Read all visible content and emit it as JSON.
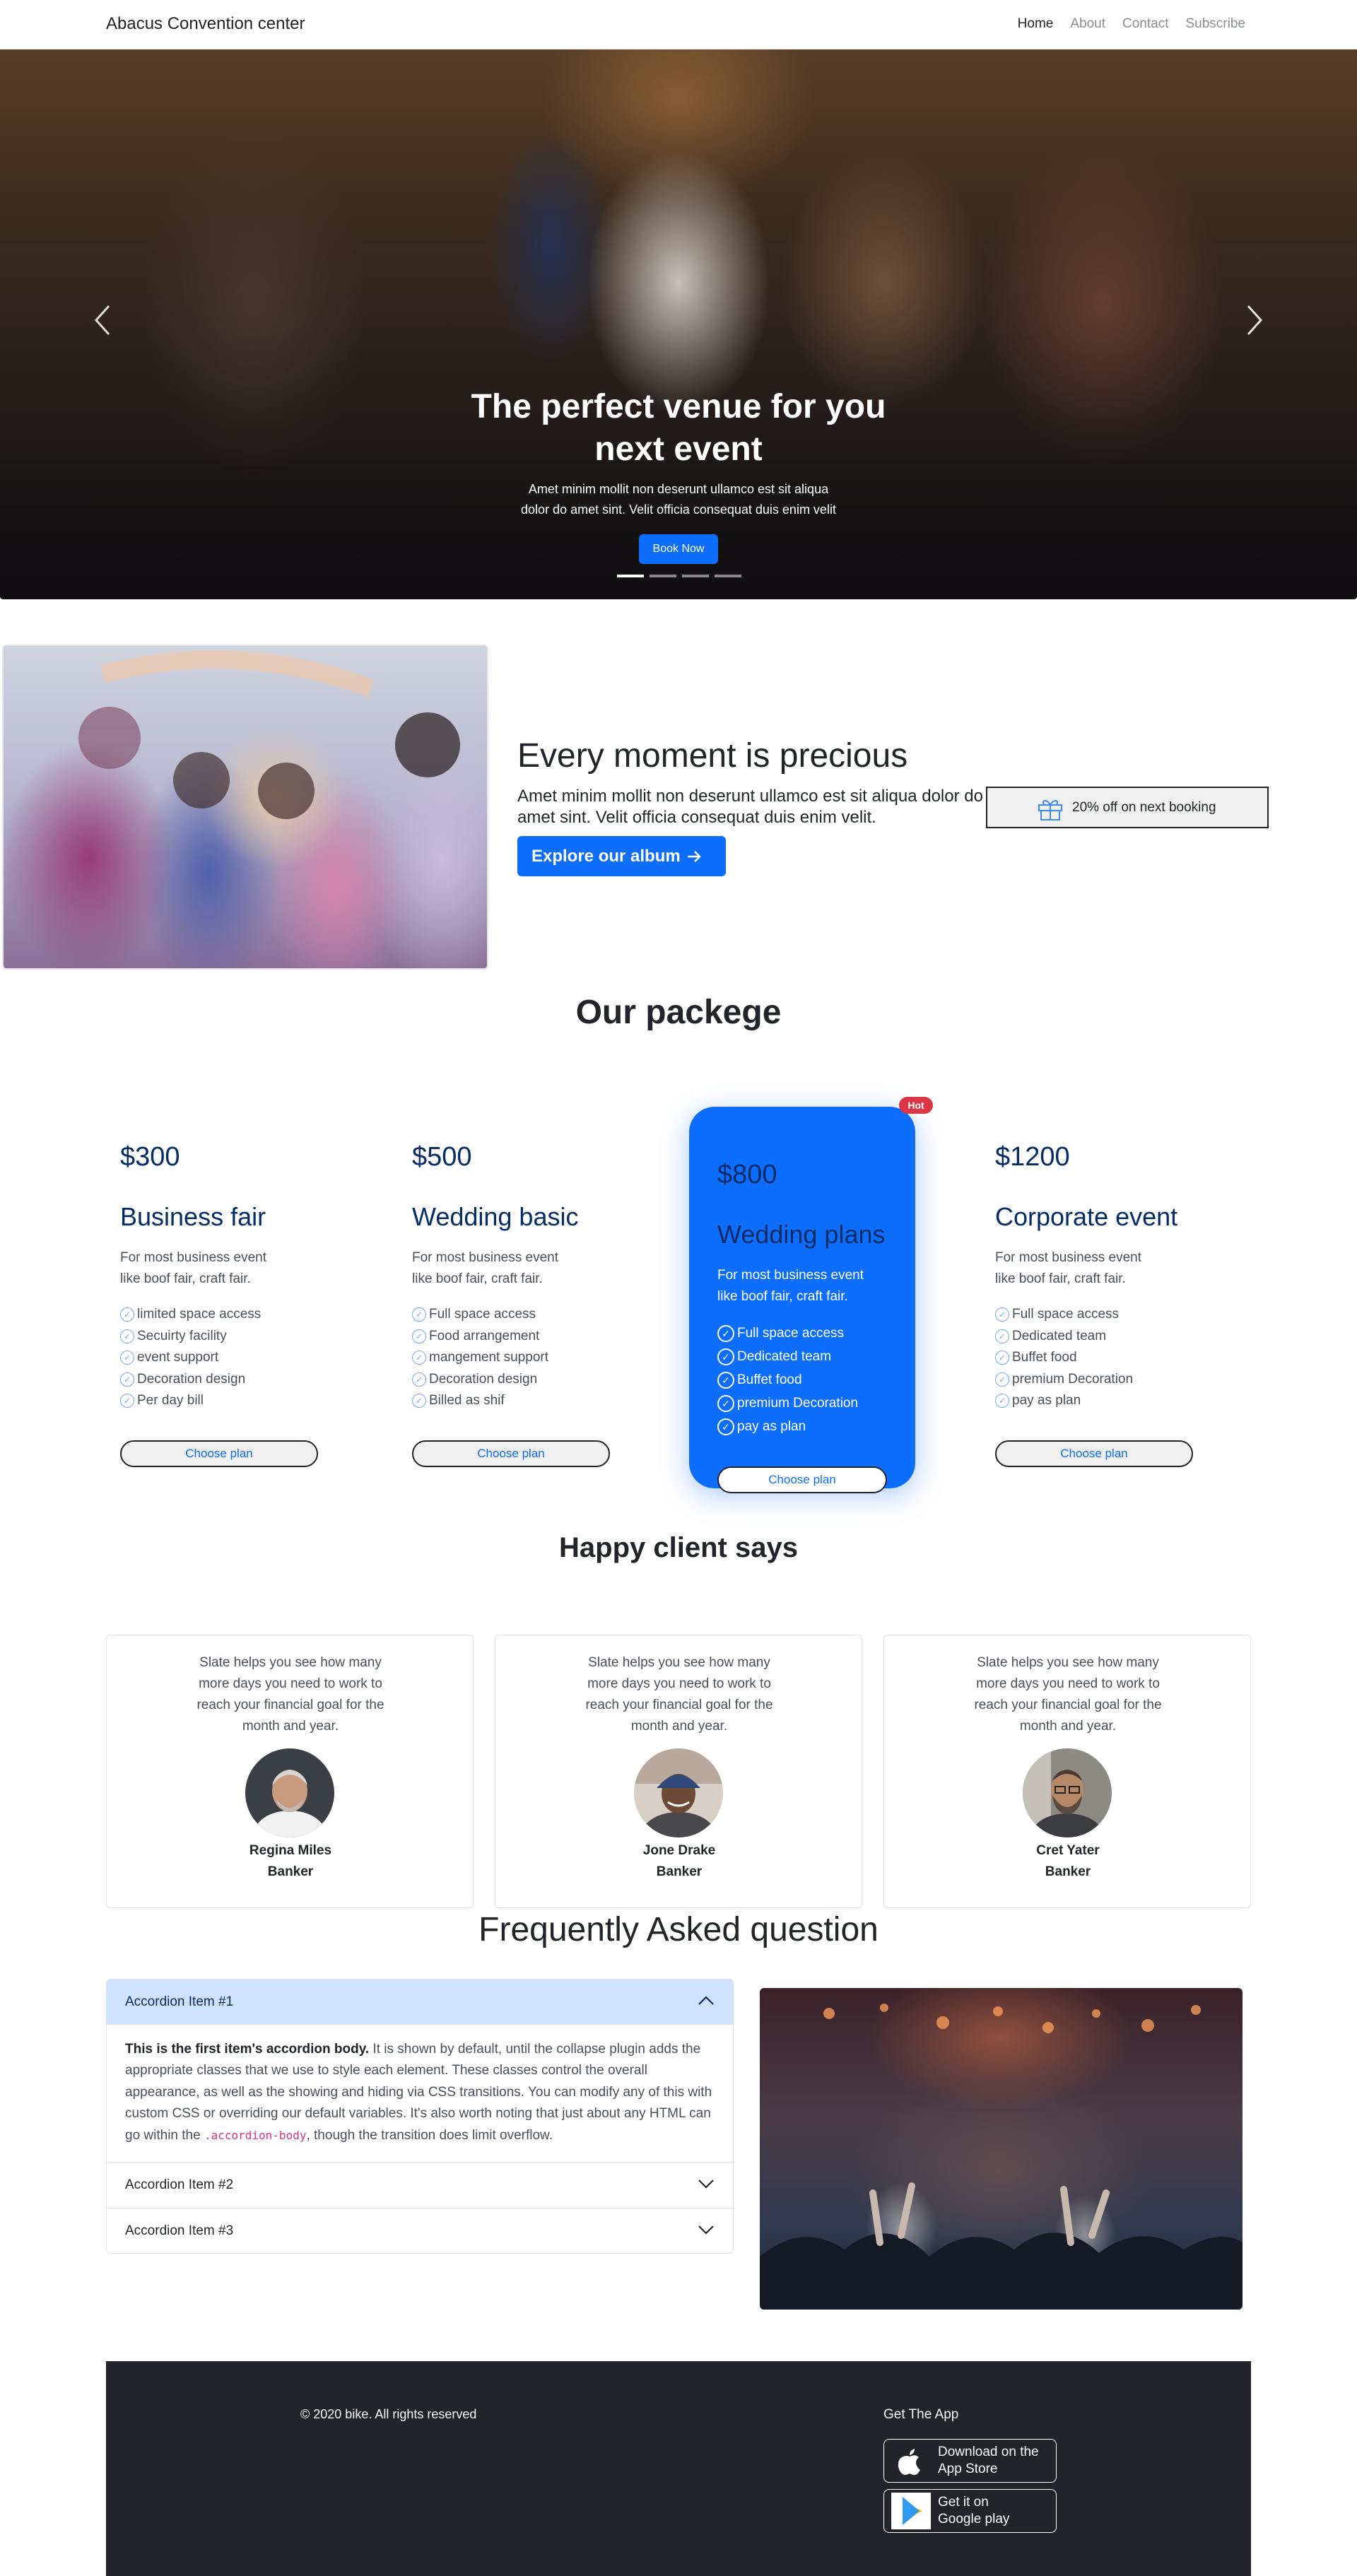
{
  "nav": {
    "brand": "Abacus Convention center",
    "links": [
      "Home",
      "About",
      "Contact",
      "Subscribe"
    ]
  },
  "hero": {
    "title_line1": "The perfect venue for you",
    "title_line2": "next event",
    "text_line1": "Amet minim mollit non deserunt ullamco est sit aliqua",
    "text_line2": "dolor do amet sint. Velit officia consequat duis enim velit",
    "button": "Book Now"
  },
  "precious": {
    "title": "Every moment is precious",
    "text": "Amet minim mollit non deserunt ullamco est sit aliqua dolor do amet sint. Velit officia consequat duis enim velit.",
    "button": "Explore our album",
    "promo": "20% off on next booking"
  },
  "packages": {
    "title": "Our packege",
    "hot_badge": "Hot",
    "choose_label": "Choose plan",
    "plans": [
      {
        "price": "$300",
        "name": "Business fair",
        "desc": "For most business event like boof fair, craft fair.",
        "features": [
          "limited space access",
          "Secuirty facility",
          "event support",
          "Decoration design",
          "Per day bill"
        ]
      },
      {
        "price": "$500",
        "name": "Wedding basic",
        "desc": "For most business event like boof fair, craft fair.",
        "features": [
          "Full space access",
          "Food arrangement",
          "mangement support",
          "Decoration design",
          "Billed as shif"
        ]
      },
      {
        "price": "$800",
        "name": "Wedding plans",
        "desc": "For most business event like boof fair, craft fair.",
        "features": [
          "Full space access",
          "Dedicated team",
          "Buffet food",
          "premium Decoration",
          "pay as plan"
        ]
      },
      {
        "price": "$1200",
        "name": "Corporate event",
        "desc": "For most business event like boof fair, craft fair.",
        "features": [
          "Full space access",
          "Dedicated team",
          "Buffet food",
          "premium Decoration",
          "pay as plan"
        ]
      }
    ]
  },
  "testimonials": {
    "title": "Happy client says",
    "items": [
      {
        "quote": "Slate helps you see how many more days you need to work to reach your financial goal for the month and year.",
        "name": "Regina Miles",
        "role": "Banker"
      },
      {
        "quote": "Slate helps you see how many more days you need to work to reach your financial goal for the month and year.",
        "name": "Jone Drake",
        "role": "Banker"
      },
      {
        "quote": "Slate helps you see how many more days you need to work to reach your financial goal for the month and year.",
        "name": "Cret Yater",
        "role": "Banker"
      }
    ]
  },
  "faq": {
    "title": "Frequently Asked question",
    "items": [
      {
        "label": "Accordion Item #1"
      },
      {
        "label": "Accordion Item #2"
      },
      {
        "label": "Accordion Item #3"
      }
    ],
    "body_bold": "This is the first item's accordion body.",
    "body_text": " It is shown by default, until the collapse plugin adds the appropriate classes that we use to style each element. These classes control the overall appearance, as well as the showing and hiding via CSS transitions. You can modify any of this with custom CSS or overriding our default variables. It's also worth noting that just about any HTML can go within the ",
    "body_code": ".accordion-body",
    "body_end": ", though the transition does limit overflow."
  },
  "footer": {
    "copyright": "© 2020 bike. All rights reserved",
    "get_app": "Get The App",
    "appstore_line1": "Download on the",
    "appstore_line2": "App Store",
    "googleplay_line1": "Get it on",
    "googleplay_line2": "Google play"
  },
  "colors": {
    "primary": "#0d6efd",
    "dark_navy": "#052c65",
    "danger": "#dc3545",
    "footer_bg": "#212529",
    "accordion_open_bg": "#cfe2ff"
  },
  "icons": [
    "chevron-left-icon",
    "chevron-right-icon",
    "arrow-right-icon",
    "gift-icon",
    "check-circle-icon",
    "chevron-up-icon",
    "chevron-down-icon",
    "apple-icon",
    "google-play-icon"
  ]
}
